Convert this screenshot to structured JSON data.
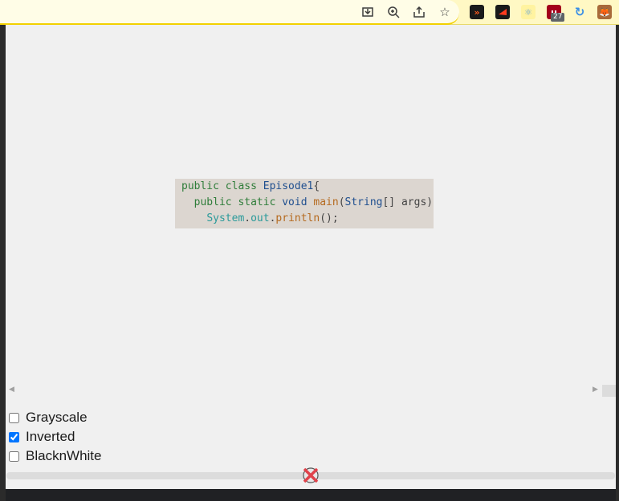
{
  "toolbar": {
    "icons": [
      "install-icon",
      "zoom-icon",
      "share-icon",
      "bookmark-star-icon"
    ],
    "extensions": [
      "ext-arrows-icon",
      "ext-flag-icon",
      "ext-react-icon",
      "ext-ublock-icon",
      "ext-sync-icon",
      "ext-fox-icon"
    ],
    "ublock_badge": "27"
  },
  "preview": {
    "lines": [
      "public class Episode1{",
      "  public static void main(String[] args)",
      "    System.out.println();"
    ]
  },
  "options": {
    "grayscale_label": "Grayscale",
    "grayscale_checked": false,
    "inverted_label": "Inverted",
    "inverted_checked": true,
    "blacknwhite_label": "BlacknWhite",
    "blacknwhite_checked": false
  },
  "slider": {
    "value_fraction": 0.5
  },
  "colors": {
    "toolbar_bg": "#fff8c4",
    "popup_bg": "#f0f0f0",
    "accent": "#1a73e8"
  }
}
